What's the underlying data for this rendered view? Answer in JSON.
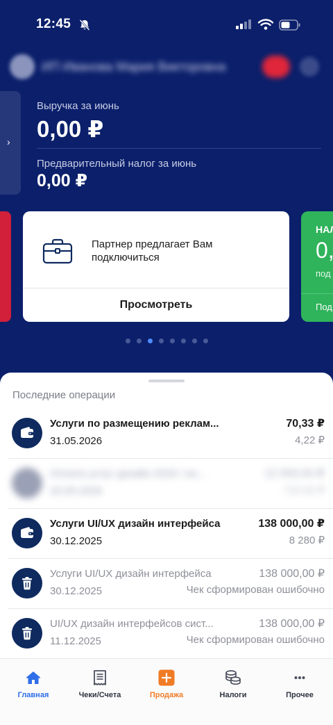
{
  "status_bar": {
    "time": "12:45"
  },
  "header": {
    "profile_name": "ИП Иванова Мария Викторовна"
  },
  "summary": {
    "revenue_label": "Выручка за июнь",
    "revenue_value": "0,00 ₽",
    "tax_label": "Предварительный налог за июнь",
    "tax_value": "0,00 ₽",
    "left_arrow": "›"
  },
  "card": {
    "text": "Партнер предлагает Вам подключиться",
    "button": "Просмотреть"
  },
  "green_card": {
    "title": "НАЛ",
    "value": "0,",
    "sub": "под",
    "footer": "Под"
  },
  "sheet": {
    "title": "Последние операции"
  },
  "operations": [
    {
      "title": "Услуги по размещению реклам...",
      "date": "31.05.2026",
      "amount": "70,33 ₽",
      "tax": "4,22 ₽",
      "icon": "wallet-icon"
    },
    {
      "title": "Оплата услуг дизайн 2026 / ин...",
      "date": "20.05.2026",
      "amount": "12 000,00 ₽",
      "tax": "720,00 ₽",
      "icon": "wallet-icon"
    },
    {
      "title": "Услуги UI/UX дизайн интерфейса",
      "date": "30.12.2025",
      "amount": "138 000,00 ₽",
      "tax": "8 280 ₽",
      "icon": "wallet-icon"
    },
    {
      "title": "Услуги UI/UX дизайн интерфейса",
      "date": "30.12.2025",
      "amount": "138 000,00 ₽",
      "tax": "Чек сформирован ошибочно",
      "icon": "trash-icon"
    },
    {
      "title": "UI/UX дизайн интерфейсов сист...",
      "date": "11.12.2025",
      "amount": "138 000,00 ₽",
      "tax": "Чек сформирован ошибочно",
      "icon": "trash-icon"
    }
  ],
  "tabs": [
    {
      "label": "Главная",
      "icon": "home-icon"
    },
    {
      "label": "Чеки/Счета",
      "icon": "receipt-icon"
    },
    {
      "label": "Продажа",
      "icon": "plus-icon"
    },
    {
      "label": "Налоги",
      "icon": "coins-icon"
    },
    {
      "label": "Прочее",
      "icon": "more-icon"
    }
  ],
  "colors": {
    "header_bg": "#0b1f6b",
    "accent_blue": "#2f6ee8",
    "sale_orange": "#f07b25",
    "green_card": "#2fb35b",
    "red_card": "#d21f3a",
    "op_icon_bg": "#0e2a5f"
  }
}
